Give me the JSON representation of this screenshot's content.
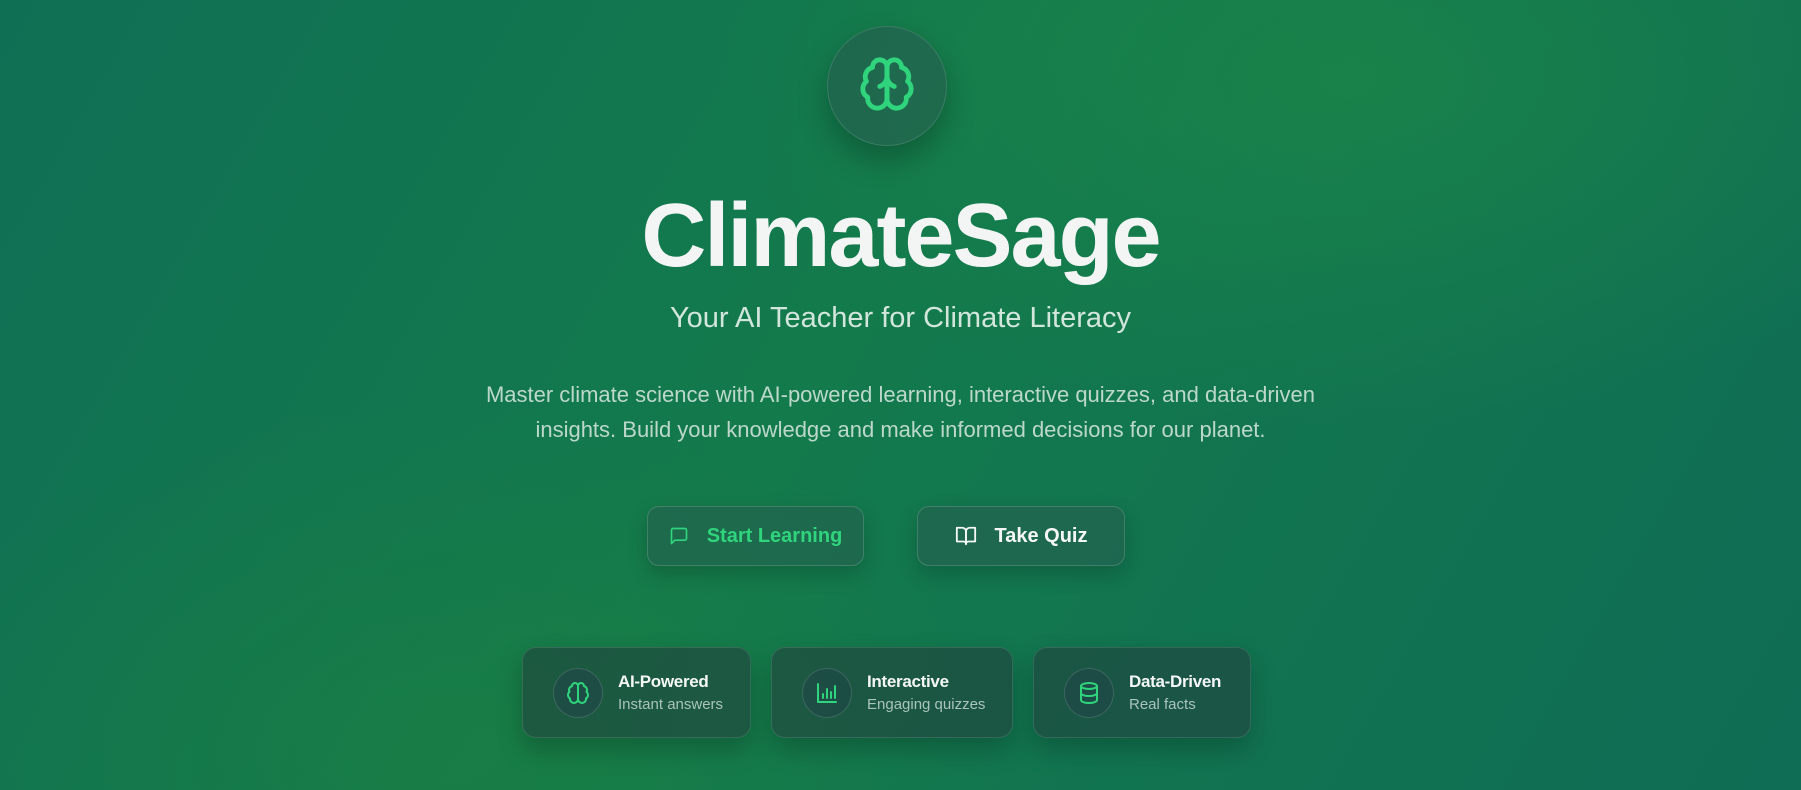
{
  "app": {
    "logo_icon": "brain-icon",
    "title": "ClimateSage",
    "subtitle": "Your AI Teacher for Climate Literacy",
    "description": "Master climate science with AI-powered learning, interactive quizzes, and data-driven insights. Build your knowledge and make informed decisions for our planet."
  },
  "actions": {
    "start_learning": {
      "label": "Start Learning",
      "icon": "message-square-icon"
    },
    "take_quiz": {
      "label": "Take Quiz",
      "icon": "book-open-icon"
    }
  },
  "features": [
    {
      "title": "AI-Powered",
      "subtitle": "Instant answers",
      "icon": "brain-icon"
    },
    {
      "title": "Interactive",
      "subtitle": "Engaging quizzes",
      "icon": "bar-chart-icon"
    },
    {
      "title": "Data-Driven",
      "subtitle": "Real facts",
      "icon": "database-icon"
    }
  ],
  "colors": {
    "accent": "#2fd47d",
    "background_start": "#0f6f55",
    "background_mid": "#137a4c",
    "text": "#f2f5f4"
  }
}
